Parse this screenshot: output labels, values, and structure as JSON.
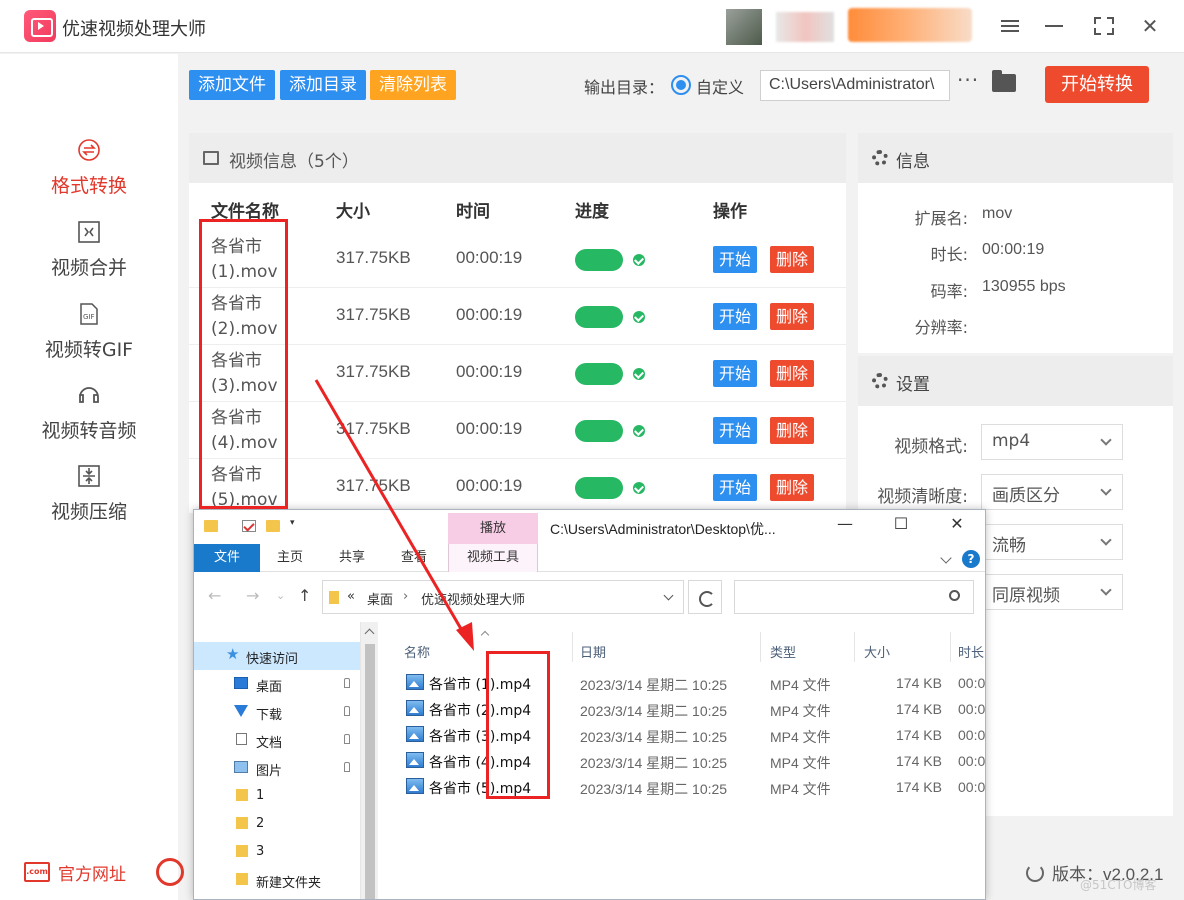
{
  "app": {
    "title": "优速视频处理大师",
    "window_controls": [
      "menu-icon",
      "minimize-icon",
      "fullscreen-icon",
      "close-icon"
    ]
  },
  "sidebar": {
    "items": [
      {
        "label": "格式转换",
        "icon": "format-convert-icon",
        "active": true
      },
      {
        "label": "视频合并",
        "icon": "merge-icon",
        "active": false
      },
      {
        "label": "视频转GIF",
        "icon": "gif-icon",
        "active": false
      },
      {
        "label": "视频转音频",
        "icon": "audio-icon",
        "active": false
      },
      {
        "label": "视频压缩",
        "icon": "compress-icon",
        "active": false
      }
    ],
    "official_site": "官方网址"
  },
  "toolbar": {
    "add_file": "添加文件",
    "add_dir": "添加目录",
    "clear_list": "清除列表",
    "output_label": "输出目录：",
    "output_option": "自定义",
    "output_path": "C:\\Users\\Administrator\\",
    "more": "···",
    "start_convert": "开始转换"
  },
  "video_list": {
    "title": "视频信息（5个）",
    "headers": {
      "name": "文件名称",
      "size": "大小",
      "time": "时间",
      "progress": "进度",
      "action": "操作"
    },
    "rows": [
      {
        "name": "各省市 (1).mov",
        "size": "317.75KB",
        "time": "00:00:19",
        "progress": 1.0
      },
      {
        "name": "各省市 (2).mov",
        "size": "317.75KB",
        "time": "00:00:19",
        "progress": 1.0
      },
      {
        "name": "各省市 (3).mov",
        "size": "317.75KB",
        "time": "00:00:19",
        "progress": 1.0
      },
      {
        "name": "各省市 (4).mov",
        "size": "317.75KB",
        "time": "00:00:19",
        "progress": 1.0
      },
      {
        "name": "各省市 (5).mov",
        "size": "317.75KB",
        "time": "00:00:19",
        "progress": 1.0
      }
    ],
    "start_label": "开始",
    "delete_label": "删除"
  },
  "info": {
    "title": "信息",
    "ext_k": "扩展名:",
    "ext_v": "mov",
    "dur_k": "时长:",
    "dur_v": "00:00:19",
    "rate_k": "码率:",
    "rate_v": "130955 bps",
    "res_k": "分辨率:",
    "res_v": ""
  },
  "settings": {
    "title": "设置",
    "format_k": "视频格式:",
    "format_v": "mp4",
    "quality_k": "视频清晰度:",
    "quality_v": "画质区分",
    "fluency_v": "流畅",
    "resolution_v": "同原视频"
  },
  "version": "版本：v2.0.2.1",
  "watermark": "@51CTO博客",
  "explorer": {
    "contextual_tab": "播放",
    "title": "C:\\Users\\Administrator\\Desktop\\优...",
    "tabs": [
      "文件",
      "主页",
      "共享",
      "查看"
    ],
    "contextual_sub": "视频工具",
    "address": [
      "桌面",
      "优速视频处理大师"
    ],
    "address_prefix": "«",
    "nav": [
      {
        "label": "快速访问",
        "icon": "star",
        "sel": true
      },
      {
        "label": "桌面",
        "icon": "desk",
        "pin": true
      },
      {
        "label": "下载",
        "icon": "down",
        "pin": true
      },
      {
        "label": "文档",
        "icon": "doc",
        "pin": true
      },
      {
        "label": "图片",
        "icon": "pic",
        "pin": true
      },
      {
        "label": "1",
        "icon": "fold"
      },
      {
        "label": "2",
        "icon": "fold"
      },
      {
        "label": "3",
        "icon": "fold"
      },
      {
        "label": "新建文件夹",
        "icon": "fold"
      }
    ],
    "headers": {
      "name": "名称",
      "date": "日期",
      "type": "类型",
      "size": "大小",
      "dur": "时长"
    },
    "files": [
      {
        "name": "各省市 (1).mp4",
        "date": "2023/3/14 星期二 10:25",
        "type": "MP4 文件",
        "size": "174 KB",
        "dur": "00:0"
      },
      {
        "name": "各省市 (2).mp4",
        "date": "2023/3/14 星期二 10:25",
        "type": "MP4 文件",
        "size": "174 KB",
        "dur": "00:0"
      },
      {
        "name": "各省市 (3).mp4",
        "date": "2023/3/14 星期二 10:25",
        "type": "MP4 文件",
        "size": "174 KB",
        "dur": "00:0"
      },
      {
        "name": "各省市 (4).mp4",
        "date": "2023/3/14 星期二 10:25",
        "type": "MP4 文件",
        "size": "174 KB",
        "dur": "00:0"
      },
      {
        "name": "各省市 (5).mp4",
        "date": "2023/3/14 星期二 10:25",
        "type": "MP4 文件",
        "size": "174 KB",
        "dur": "00:0"
      }
    ]
  },
  "colors": {
    "accent_red": "#e2382c",
    "primary_blue": "#2d8ff0",
    "warn_orange": "#ffa420",
    "success_green": "#27b864",
    "annotation_red": "#ec2323"
  }
}
